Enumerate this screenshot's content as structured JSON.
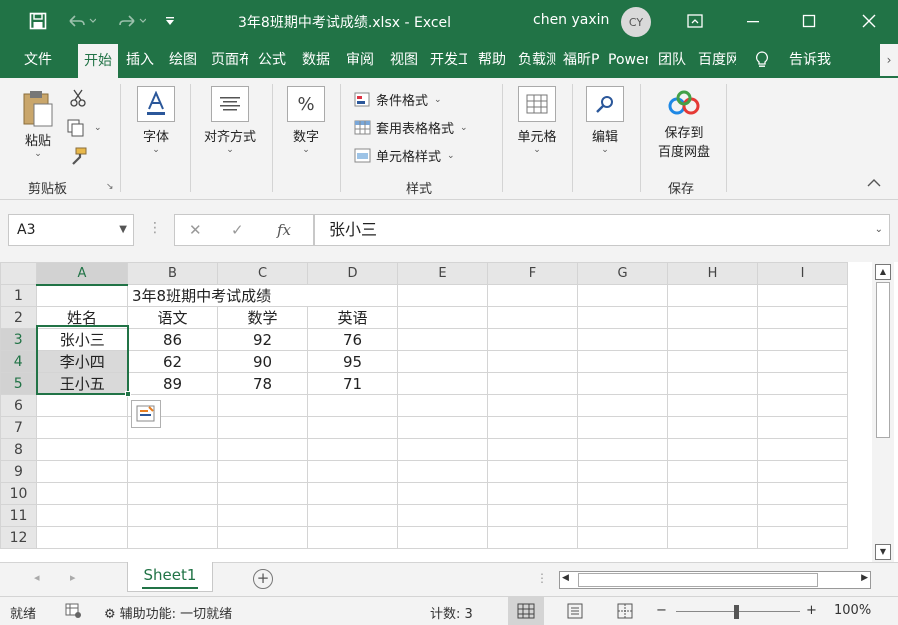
{
  "titlebar": {
    "title": "3年8班期中考试成绩.xlsx  -  Excel",
    "user": "chen yaxin",
    "avatar": "CY"
  },
  "tabs": [
    {
      "label": "文件"
    },
    {
      "label": "开始"
    },
    {
      "label": "插入"
    },
    {
      "label": "绘图"
    },
    {
      "label": "页面布局"
    },
    {
      "label": "公式"
    },
    {
      "label": "数据"
    },
    {
      "label": "审阅"
    },
    {
      "label": "视图"
    },
    {
      "label": "开发工具"
    },
    {
      "label": "帮助"
    },
    {
      "label": "负载测试"
    },
    {
      "label": "福昕PDF"
    },
    {
      "label": "Power Pivot"
    },
    {
      "label": "团队"
    },
    {
      "label": "百度网盘"
    },
    {
      "label": "告诉我"
    }
  ],
  "ribbon": {
    "clipboard": {
      "paste": "粘贴",
      "group": "剪贴板"
    },
    "font": {
      "label": "字体"
    },
    "align": {
      "label": "对齐方式"
    },
    "number": {
      "label": "数字",
      "icon_text": "%"
    },
    "styles": {
      "conditional": "条件格式",
      "table": "套用表格格式",
      "cell": "单元格样式",
      "group": "样式"
    },
    "cells": {
      "label": "单元格"
    },
    "edit": {
      "label": "编辑"
    },
    "save": {
      "line1": "保存到",
      "line2": "百度网盘",
      "group": "保存"
    }
  },
  "formula": {
    "namebox": "A3",
    "value": "张小三"
  },
  "grid": {
    "columns": [
      "A",
      "B",
      "C",
      "D",
      "E",
      "F",
      "G",
      "H",
      "I"
    ],
    "rows": [
      "1",
      "2",
      "3",
      "4",
      "5",
      "6",
      "7",
      "8",
      "9",
      "10",
      "11",
      "12"
    ],
    "title": "3年8班期中考试成绩",
    "header": [
      "姓名",
      "语文",
      "数学",
      "英语"
    ],
    "students": [
      [
        "张小三",
        "86",
        "92",
        "76"
      ],
      [
        "李小四",
        "62",
        "90",
        "95"
      ],
      [
        "王小五",
        "89",
        "78",
        "71"
      ]
    ]
  },
  "sheets": [
    {
      "name": "Sheet1"
    }
  ],
  "status": {
    "ready": "就绪",
    "accessibility": "辅助功能: 一切就绪",
    "count": "计数: 3",
    "zoom": "100%"
  },
  "colors": {
    "accent": "#217346",
    "selected_fill": "#d9d9d9"
  }
}
